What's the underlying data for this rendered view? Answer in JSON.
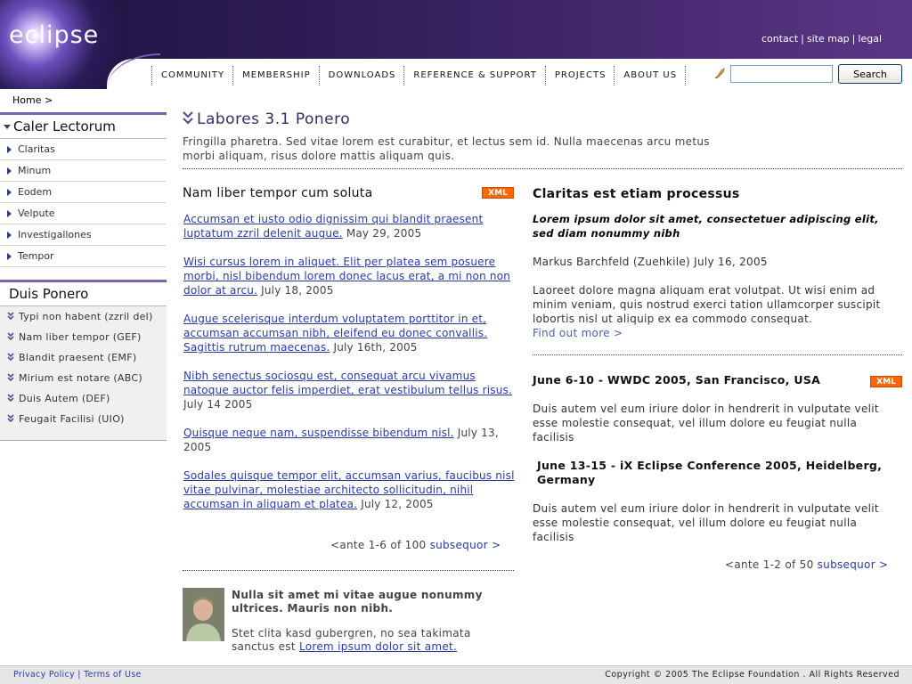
{
  "header": {
    "logo_text": "eclipse",
    "top_links": [
      "contact",
      "site map",
      "legal"
    ],
    "nav": [
      "COMMUNITY",
      "MEMBERSHIP",
      "DOWNLOADS",
      "REFERENCE & SUPPORT",
      "PROJECTS",
      "ABOUT US"
    ],
    "search": {
      "placeholder": "",
      "button_label": "Search"
    }
  },
  "breadcrumb": "Home >",
  "sidebar": {
    "box1": {
      "title": "Caler Lectorum",
      "items": [
        "Claritas",
        "Minum",
        "Eodem",
        "Velpute",
        "Investigallones",
        "Tempor"
      ]
    },
    "box2": {
      "title": "Duis Ponero",
      "items": [
        "Typi non habent (zzril del)",
        "Nam liber tempor (GEF)",
        "Blandit praesent (EMF)",
        "Mirium est notare (ABC)",
        "Duis Autem (DEF)",
        "Feugait Facilisi (UIO)"
      ]
    }
  },
  "main": {
    "title": "Labores 3.1 Ponero",
    "intro": "Fringilla pharetra. Sed vitae lorem est curabitur, et lectus sem id. Nulla maecenas arcu metus morbi aliquam, risus dolore mattis aliquam quis.",
    "left": {
      "title": "Nam liber tempor cum soluta",
      "xml_label": "XML",
      "news": [
        {
          "link": "Accumsan et iusto odio dignissim qui blandit praesent luptatum zzril delenit augue.",
          "date": "May 29, 2005"
        },
        {
          "link": "Wisi cursus lorem in aliquet. Elit per platea sem posuere morbi, nisl bibendum lorem donec lacus erat, a mi non non dolor at arcu.",
          "date": "July 18, 2005"
        },
        {
          "link": "Augue scelerisque interdum voluptatem porttitor in et, accumsan accumsan nibh, eleifend eu donec convallis. Sagittis rutrum maecenas.",
          "date": "July 16th, 2005"
        },
        {
          "link": "Nibh senectus sociosqu est, consequat arcu vivamus natoque auctor felis imperdiet, erat vestibulum tellus risus.",
          "date": "July 14 2005"
        },
        {
          "link": "Quisque neque nam, suspendisse bibendum nisl.",
          "date": "July 13, 2005"
        },
        {
          "link": "Sodales quisque tempor elit, accumsan varius, faucibus nisl vitae pulvinar, molestiae architecto sollicitudin, nihil accumsan in aliquam et platea.",
          "date": "July 12, 2005"
        }
      ],
      "pager": {
        "prev": "<ante",
        "range": "1-6 of 100",
        "next": "subsequor >"
      },
      "profile": {
        "title": "Nulla sit amet mi vitae augue nonummy ultrices. Mauris non nibh.",
        "text": "Stet clita kasd gubergren, no sea takimata sanctus est",
        "link": "Lorem ipsum dolor sit amet."
      }
    },
    "right": {
      "title": "Claritas est etiam processus",
      "lead": "Lorem ipsum dolor sit amet, consectetuer adipiscing elit, sed diam nonummy nibh",
      "byline": "Markus Barchfeld (Zuehkile) July 16, 2005",
      "body": "Laoreet dolore magna aliquam erat volutpat. Ut wisi enim ad minim veniam, quis nostrud exerci tation ullamcorper suscipit lobortis nisl ut aliquip ex ea commodo consequat.",
      "find_more": "Find out more >",
      "events_xml_label": "XML",
      "events": [
        {
          "title": "June 6-10 - WWDC 2005, San Francisco, USA",
          "text": "Duis autem vel eum iriure dolor in hendrerit in vulputate velit esse molestie consequat, vel illum dolore eu feugiat nulla facilisis"
        },
        {
          "title": "June 13-15 - iX Eclipse Conference 2005, Heidelberg, Germany",
          "text": "Duis autem vel eum iriure dolor in hendrerit in vulputate velit esse molestie consequat, vel illum dolore eu feugiat nulla facilisis"
        }
      ],
      "pager": {
        "prev": "<ante",
        "range": "1-2 of 50",
        "next": "subsequor >"
      }
    }
  },
  "footer": {
    "privacy": "Privacy Policy",
    "terms": "Terms of Use",
    "copyright": "Copyright © 2005  The Eclipse Foundation . All Rights Reserved"
  }
}
